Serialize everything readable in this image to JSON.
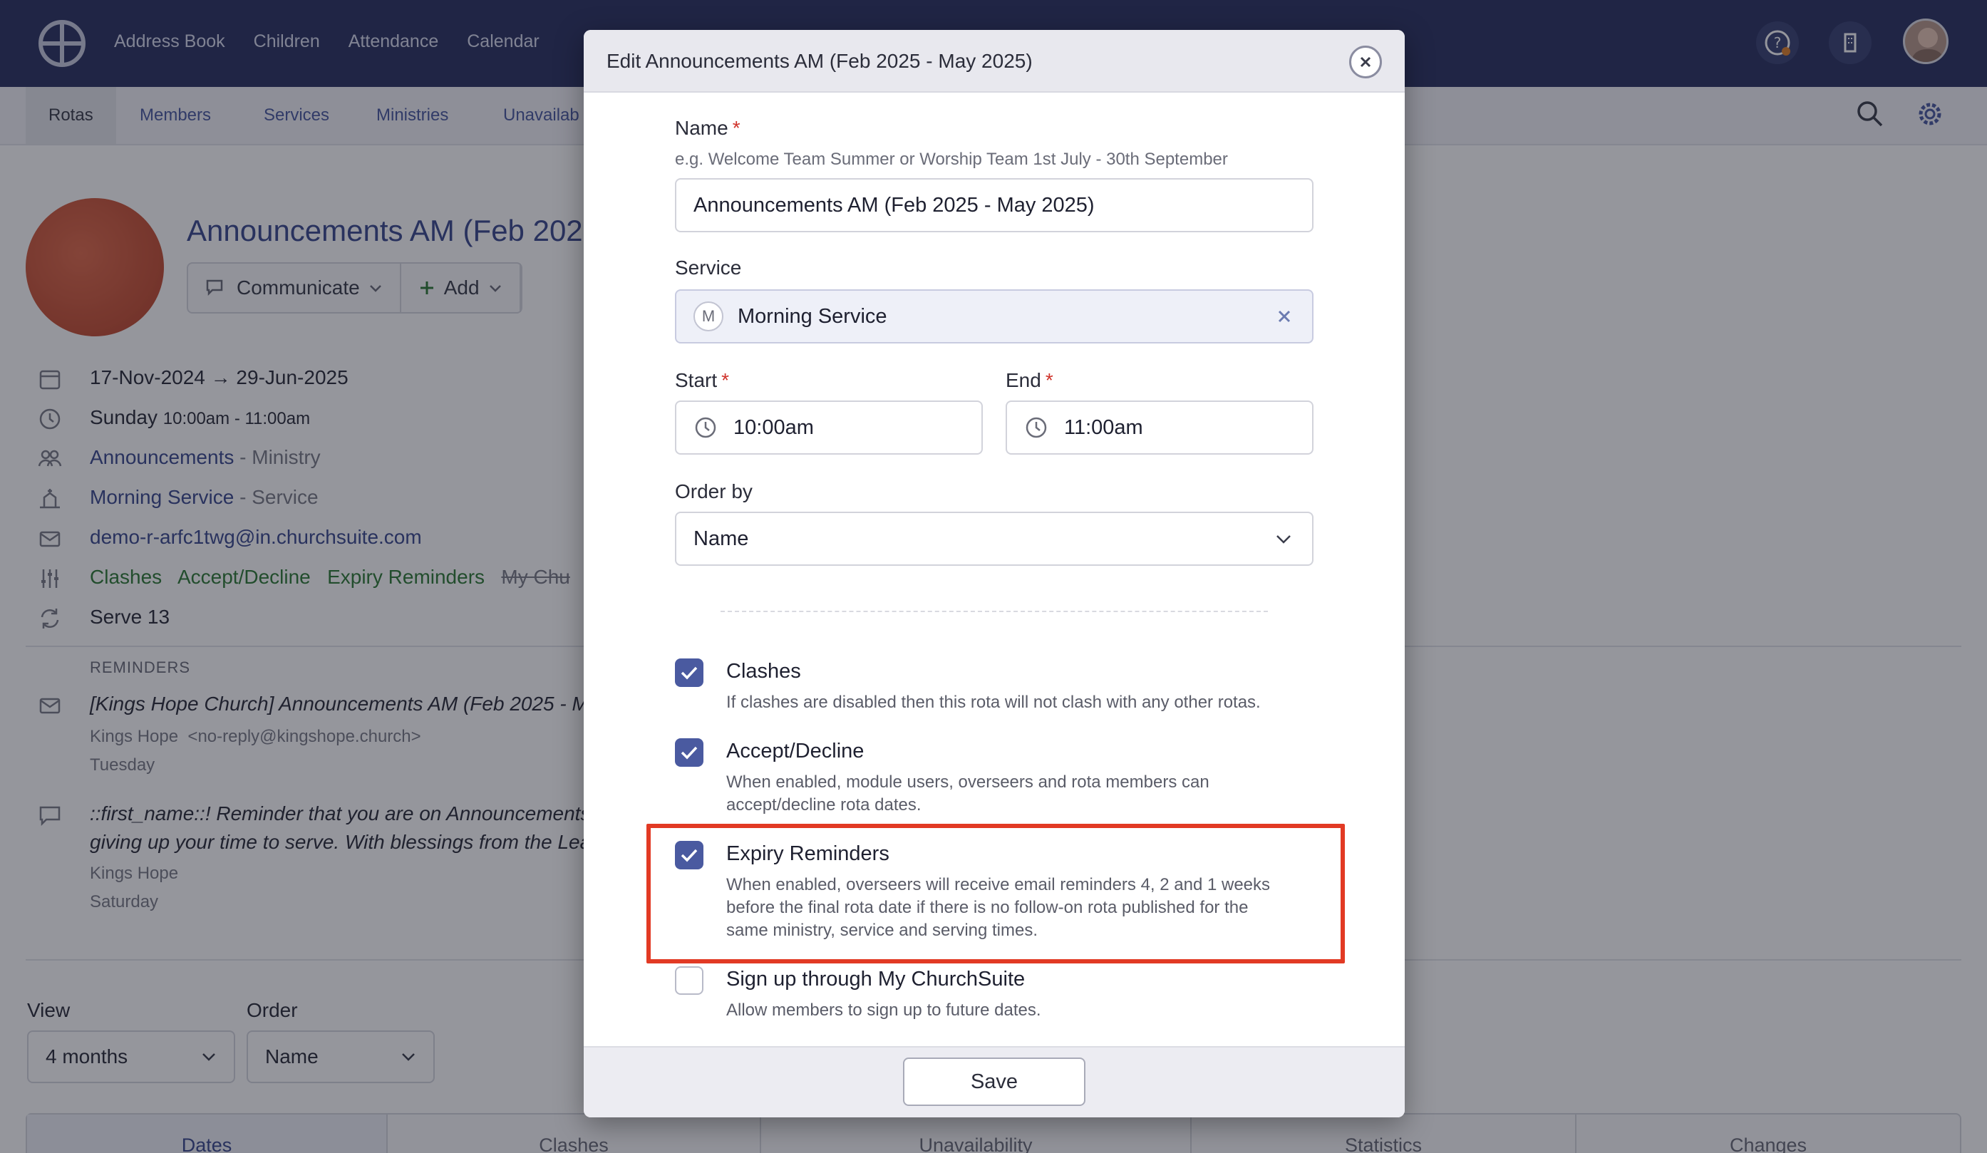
{
  "topnav": {
    "items": [
      "Address Book",
      "Children",
      "Attendance",
      "Calendar"
    ]
  },
  "subnav": {
    "items": [
      "Rotas",
      "Members",
      "Services",
      "Ministries",
      "Unavailab"
    ]
  },
  "rota": {
    "title": "Announcements AM (Feb 202",
    "buttons": {
      "communicate": "Communicate",
      "add": "Add"
    },
    "dates": "17-Nov-2024 → 29-Jun-2025",
    "day": "Sunday",
    "time": "10:00am - 11:00am",
    "ministry_name": "Announcements",
    "ministry_suffix": "- Ministry",
    "service_name": "Morning Service",
    "service_suffix": "- Service",
    "email": "demo-r-arfc1twg@in.churchsuite.com",
    "flags": [
      "Clashes",
      "Accept/Decline",
      "Expiry Reminders"
    ],
    "flag_struck": "My Chu",
    "serve": "Serve 13",
    "reminders_label": "REMINDERS",
    "reminder1_subject": "[Kings Hope Church] Announcements AM (Feb 2025 - Ma",
    "reminder1_from_name": "Kings Hope",
    "reminder1_from_email": "<no-reply@kingshope.church>",
    "reminder1_day": "Tuesday",
    "reminder2_line1": "::first_name::! Reminder that you are on Announcements",
    "reminder2_line2": "giving up your time to serve. With blessings from the Lea",
    "reminder2_from": "Kings Hope",
    "reminder2_day": "Saturday"
  },
  "view": {
    "label": "View",
    "value": "4 months"
  },
  "order": {
    "label": "Order",
    "value": "Name"
  },
  "tabs": [
    "Dates",
    "Clashes",
    "Unavailability",
    "Statistics",
    "Changes"
  ],
  "modal": {
    "title": "Edit Announcements AM (Feb 2025 - May 2025)",
    "name_label": "Name",
    "required_mark": "*",
    "name_help": "e.g. Welcome Team Summer or Worship Team 1st July - 30th September",
    "name_value": "Announcements AM (Feb 2025 - May 2025)",
    "service_label": "Service",
    "service_chip": "M",
    "service_value": "Morning Service",
    "start_label": "Start",
    "start_value": "10:00am",
    "end_label": "End",
    "end_value": "11:00am",
    "order_label": "Order by",
    "order_value": "Name",
    "options": [
      {
        "title": "Clashes",
        "desc": "If clashes are disabled then this rota will not clash with any other rotas.",
        "checked": true
      },
      {
        "title": "Accept/Decline",
        "desc": "When enabled, module users, overseers and rota members can accept/decline rota dates.",
        "checked": true
      },
      {
        "title": "Expiry Reminders",
        "desc": "When enabled, overseers will receive email reminders 4, 2 and 1 weeks before the final rota date if there is no follow-on rota published for the same ministry, service and serving times.",
        "checked": true
      },
      {
        "title": "Sign up through My ChurchSuite",
        "desc": "Allow members to sign up to future dates.",
        "checked": false
      }
    ],
    "save_label": "Save"
  },
  "colors": {
    "topbar": "#2a3262",
    "accent": "#4a5aa0",
    "highlight": "#e23a24",
    "required": "#d0342c"
  }
}
